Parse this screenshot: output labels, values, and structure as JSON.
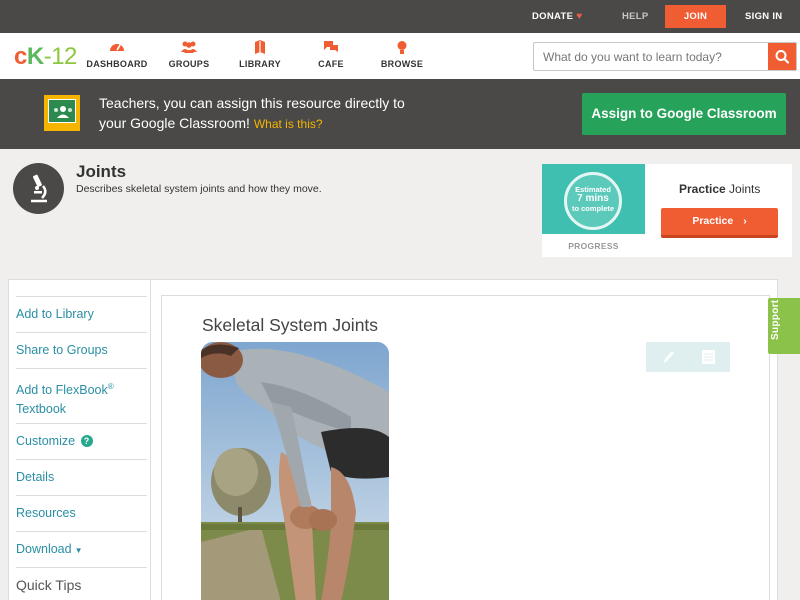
{
  "topbar": {
    "donate": "DONATE",
    "help": "HELP",
    "join": "JOIN",
    "signin": "SIGN IN"
  },
  "logo": {
    "c": "c",
    "k": "K",
    "n": "-12"
  },
  "nav": [
    {
      "label": "DASHBOARD",
      "icon": "dashboard-icon"
    },
    {
      "label": "GROUPS",
      "icon": "groups-icon"
    },
    {
      "label": "LIBRARY",
      "icon": "library-icon"
    },
    {
      "label": "CAFE",
      "icon": "cafe-icon"
    },
    {
      "label": "BROWSE",
      "icon": "browse-icon"
    }
  ],
  "search": {
    "placeholder": "What do you want to learn today?"
  },
  "banner": {
    "line1": "Teachers, you can assign this resource directly to",
    "line2": "your Google Classroom!",
    "whatis": "What is this?",
    "assign": "Assign to Google Classroom"
  },
  "concept": {
    "title": "Joints",
    "description": "Describes skeletal system joints and how they move."
  },
  "practice": {
    "estimated": "Estimated",
    "mins": "7 mins",
    "complete": "to complete",
    "progress": "PROGRESS",
    "title_bold": "Practice",
    "title_rest": " Joints",
    "button": "Practice"
  },
  "sidebar": {
    "add_library": "Add to Library",
    "share_groups": "Share to Groups",
    "add_flexbook": "Add to FlexBook",
    "reg": "®",
    "textbook": "Textbook",
    "customize": "Customize",
    "qm": "?",
    "details": "Details",
    "resources": "Resources",
    "download": "Download",
    "tri": "▼",
    "quick_tips": "Quick Tips"
  },
  "article": {
    "title": "Skeletal System Joints"
  },
  "support": "Support",
  "colors": {
    "accent": "#f15d33",
    "dark": "#4a4947",
    "green": "#27a25a",
    "teal": "#3fbfaf",
    "link": "#2a8fa5"
  }
}
